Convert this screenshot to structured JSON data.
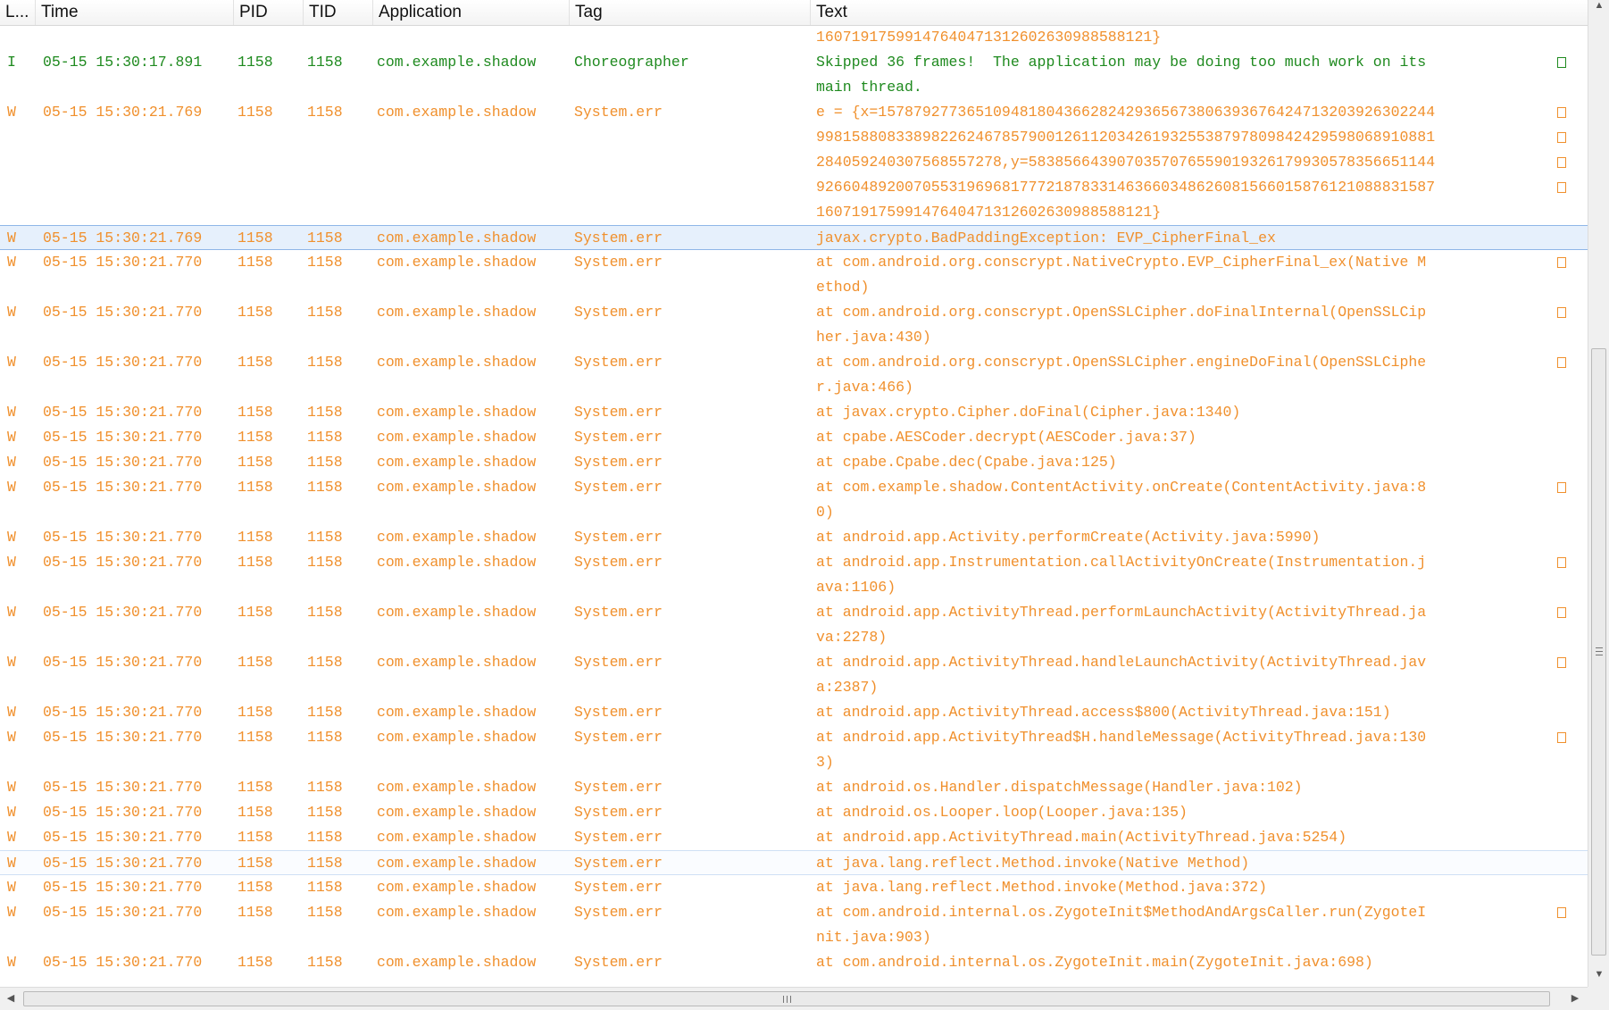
{
  "columns": [
    {
      "key": "level",
      "label": "L..."
    },
    {
      "key": "time",
      "label": "Time"
    },
    {
      "key": "pid",
      "label": "PID"
    },
    {
      "key": "tid",
      "label": "TID"
    },
    {
      "key": "app",
      "label": "Application"
    },
    {
      "key": "tag",
      "label": "Tag"
    },
    {
      "key": "text",
      "label": "Text"
    }
  ],
  "rows": [
    {
      "level": "",
      "time": "",
      "pid": "",
      "tid": "",
      "app": "",
      "tag": "",
      "text": [
        "1607191759914764047131260263098858812​1}"
      ],
      "color": "W"
    },
    {
      "level": "I",
      "time": "05-15 15:30:17.891",
      "pid": "1158",
      "tid": "1158",
      "app": "com.example.shadow",
      "tag": "Choreographer",
      "text": [
        "Skipped 36 frames!  The application may be doing too much work on its",
        "main thread."
      ],
      "color": "I"
    },
    {
      "level": "W",
      "time": "05-15 15:30:21.769",
      "pid": "1158",
      "tid": "1158",
      "app": "com.example.shadow",
      "tag": "System.err",
      "text": [
        "e = {x=157879277365109481804366282429365673806393676424713203926302244",
        "99815880833898226246785790012611203426193255387978098424295980689108​81",
        "28405924030756855727​8,y=5838566439070357076559019326179930578356651144",
        "92660489200705531969681777218783314636603486260815660158761210888315​87",
        "1607191759914764047131260263098858812​1}"
      ],
      "color": "W"
    },
    {
      "level": "W",
      "time": "05-15 15:30:21.769",
      "pid": "1158",
      "tid": "1158",
      "app": "com.example.shadow",
      "tag": "System.err",
      "text": [
        "javax.crypto.BadPaddingException: EVP_CipherFinal_ex"
      ],
      "color": "W",
      "selected": true
    },
    {
      "level": "W",
      "time": "05-15 15:30:21.770",
      "pid": "1158",
      "tid": "1158",
      "app": "com.example.shadow",
      "tag": "System.err",
      "text": [
        "at com.android.org.conscrypt.NativeCrypto.EVP_CipherFinal_ex(Native M",
        "ethod)"
      ],
      "color": "W"
    },
    {
      "level": "W",
      "time": "05-15 15:30:21.770",
      "pid": "1158",
      "tid": "1158",
      "app": "com.example.shadow",
      "tag": "System.err",
      "text": [
        "at com.android.org.conscrypt.OpenSSLCipher.doFinalInternal(OpenSSLCip",
        "her.java:430)"
      ],
      "color": "W"
    },
    {
      "level": "W",
      "time": "05-15 15:30:21.770",
      "pid": "1158",
      "tid": "1158",
      "app": "com.example.shadow",
      "tag": "System.err",
      "text": [
        "at com.android.org.conscrypt.OpenSSLCipher.engineDoFinal(OpenSSLCiphe",
        "r.java:466)"
      ],
      "color": "W"
    },
    {
      "level": "W",
      "time": "05-15 15:30:21.770",
      "pid": "1158",
      "tid": "1158",
      "app": "com.example.shadow",
      "tag": "System.err",
      "text": [
        "at javax.crypto.Cipher.doFinal(Cipher.java:1340)"
      ],
      "color": "W"
    },
    {
      "level": "W",
      "time": "05-15 15:30:21.770",
      "pid": "1158",
      "tid": "1158",
      "app": "com.example.shadow",
      "tag": "System.err",
      "text": [
        "at cpabe.AESCoder.decrypt(AESCoder.java:37)"
      ],
      "color": "W"
    },
    {
      "level": "W",
      "time": "05-15 15:30:21.770",
      "pid": "1158",
      "tid": "1158",
      "app": "com.example.shadow",
      "tag": "System.err",
      "text": [
        "at cpabe.Cpabe.dec(Cpabe.java:125)"
      ],
      "color": "W"
    },
    {
      "level": "W",
      "time": "05-15 15:30:21.770",
      "pid": "1158",
      "tid": "1158",
      "app": "com.example.shadow",
      "tag": "System.err",
      "text": [
        "at com.example.shadow.ContentActivity.onCreate(ContentActivity.java:8",
        "0)"
      ],
      "color": "W"
    },
    {
      "level": "W",
      "time": "05-15 15:30:21.770",
      "pid": "1158",
      "tid": "1158",
      "app": "com.example.shadow",
      "tag": "System.err",
      "text": [
        "at android.app.Activity.performCreate(Activity.java:5990)"
      ],
      "color": "W"
    },
    {
      "level": "W",
      "time": "05-15 15:30:21.770",
      "pid": "1158",
      "tid": "1158",
      "app": "com.example.shadow",
      "tag": "System.err",
      "text": [
        "at android.app.Instrumentation.callActivityOnCreate(Instrumentation.j",
        "ava:1106)"
      ],
      "color": "W"
    },
    {
      "level": "W",
      "time": "05-15 15:30:21.770",
      "pid": "1158",
      "tid": "1158",
      "app": "com.example.shadow",
      "tag": "System.err",
      "text": [
        "at android.app.ActivityThread.performLaunchActivity(ActivityThread.ja",
        "va:2278)"
      ],
      "color": "W"
    },
    {
      "level": "W",
      "time": "05-15 15:30:21.770",
      "pid": "1158",
      "tid": "1158",
      "app": "com.example.shadow",
      "tag": "System.err",
      "text": [
        "at android.app.ActivityThread.handleLaunchActivity(ActivityThread.jav",
        "a:2387)"
      ],
      "color": "W"
    },
    {
      "level": "W",
      "time": "05-15 15:30:21.770",
      "pid": "1158",
      "tid": "1158",
      "app": "com.example.shadow",
      "tag": "System.err",
      "text": [
        "at android.app.ActivityThread.access$800(ActivityThread.java:151)"
      ],
      "color": "W"
    },
    {
      "level": "W",
      "time": "05-15 15:30:21.770",
      "pid": "1158",
      "tid": "1158",
      "app": "com.example.shadow",
      "tag": "System.err",
      "text": [
        "at android.app.ActivityThread$H.handleMessage(ActivityThread.java:130",
        "3)"
      ],
      "color": "W"
    },
    {
      "level": "W",
      "time": "05-15 15:30:21.770",
      "pid": "1158",
      "tid": "1158",
      "app": "com.example.shadow",
      "tag": "System.err",
      "text": [
        "at android.os.Handler.dispatchMessage(Handler.java:102)"
      ],
      "color": "W"
    },
    {
      "level": "W",
      "time": "05-15 15:30:21.770",
      "pid": "1158",
      "tid": "1158",
      "app": "com.example.shadow",
      "tag": "System.err",
      "text": [
        "at android.os.Looper.loop(Looper.java:135)"
      ],
      "color": "W"
    },
    {
      "level": "W",
      "time": "05-15 15:30:21.770",
      "pid": "1158",
      "tid": "1158",
      "app": "com.example.shadow",
      "tag": "System.err",
      "text": [
        "at android.app.ActivityThread.main(ActivityThread.java:5254)"
      ],
      "color": "W"
    },
    {
      "level": "W",
      "time": "05-15 15:30:21.770",
      "pid": "1158",
      "tid": "1158",
      "app": "com.example.shadow",
      "tag": "System.err",
      "text": [
        "at java.lang.reflect.Method.invoke(Native Method)"
      ],
      "color": "W",
      "hover": true
    },
    {
      "level": "W",
      "time": "05-15 15:30:21.770",
      "pid": "1158",
      "tid": "1158",
      "app": "com.example.shadow",
      "tag": "System.err",
      "text": [
        "at java.lang.reflect.Method.invoke(Method.java:372)"
      ],
      "color": "W"
    },
    {
      "level": "W",
      "time": "05-15 15:30:21.770",
      "pid": "1158",
      "tid": "1158",
      "app": "com.example.shadow",
      "tag": "System.err",
      "text": [
        "at com.android.internal.os.ZygoteInit$MethodAndArgsCaller.run(ZygoteI",
        "nit.java:903)"
      ],
      "color": "W"
    },
    {
      "level": "W",
      "time": "05-15 15:30:21.770",
      "pid": "1158",
      "tid": "1158",
      "app": "com.example.shadow",
      "tag": "System.err",
      "text": [
        "at com.android.internal.os.ZygoteInit.main(ZygoteInit.java:698)"
      ],
      "color": "W"
    }
  ],
  "colors": {
    "warn": "#f0902d",
    "info": "#1f8a1f",
    "selection": "#e6f0fc"
  },
  "icons": {
    "wrap": "wrap-indicator-icon",
    "up": "scroll-up-arrow-icon",
    "down": "scroll-down-arrow-icon",
    "left": "scroll-left-arrow-icon",
    "right": "scroll-right-arrow-icon"
  }
}
